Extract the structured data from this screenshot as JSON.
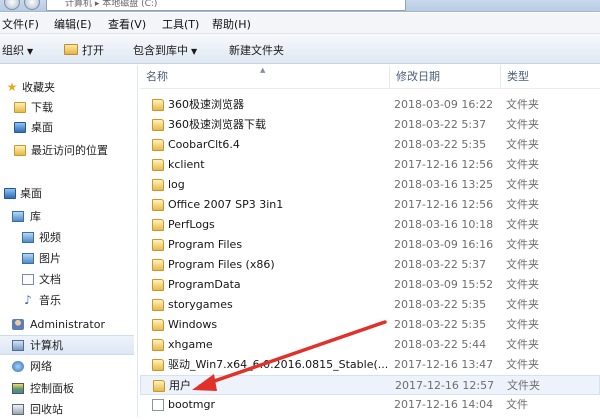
{
  "titlebar": {
    "path": "计算机 ▸ 本地磁盘 (C:)"
  },
  "menubar": {
    "items": [
      "文件(F)",
      "编辑(E)",
      "查看(V)",
      "工具(T)",
      "帮助(H)"
    ]
  },
  "toolbar": {
    "organize": "组织",
    "open": "打开",
    "include_in_library": "包含到库中",
    "new_folder": "新建文件夹"
  },
  "navpane": {
    "favorites": "收藏夹",
    "downloads": "下载",
    "desktop_fav": "桌面",
    "recent": "最近访问的位置",
    "desktop": "桌面",
    "libraries": "库",
    "videos": "视频",
    "pictures": "图片",
    "documents": "文档",
    "music": "音乐",
    "administrator": "Administrator",
    "computer": "计算机",
    "network": "网络",
    "control_panel": "控制面板",
    "recycle_bin": "回收站"
  },
  "columns": {
    "name": "名称",
    "date": "修改日期",
    "type": "类型"
  },
  "files": [
    {
      "name": "360极速浏览器",
      "date": "2018-03-09 16:22",
      "type": "文件夹",
      "icon": "folder-icon"
    },
    {
      "name": "360极速浏览器下载",
      "date": "2018-03-22 5:37",
      "type": "文件夹",
      "icon": "folder-icon"
    },
    {
      "name": "CoobarClt6.4",
      "date": "2018-03-22 5:35",
      "type": "文件夹",
      "icon": "folder-icon"
    },
    {
      "name": "kclient",
      "date": "2017-12-16 12:56",
      "type": "文件夹",
      "icon": "folder-icon"
    },
    {
      "name": "log",
      "date": "2018-03-16 13:25",
      "type": "文件夹",
      "icon": "folder-icon"
    },
    {
      "name": "Office 2007 SP3 3in1",
      "date": "2017-12-16 12:56",
      "type": "文件夹",
      "icon": "folder-icon"
    },
    {
      "name": "PerfLogs",
      "date": "2018-03-16 10:18",
      "type": "文件夹",
      "icon": "folder-icon"
    },
    {
      "name": "Program Files",
      "date": "2018-03-09 16:16",
      "type": "文件夹",
      "icon": "folder-icon"
    },
    {
      "name": "Program Files (x86)",
      "date": "2018-03-22 5:37",
      "type": "文件夹",
      "icon": "folder-icon"
    },
    {
      "name": "ProgramData",
      "date": "2018-03-09 15:52",
      "type": "文件夹",
      "icon": "folder-icon"
    },
    {
      "name": "storygames",
      "date": "2018-03-22 5:35",
      "type": "文件夹",
      "icon": "folder-icon"
    },
    {
      "name": "Windows",
      "date": "2018-03-22 5:35",
      "type": "文件夹",
      "icon": "folder-icon"
    },
    {
      "name": "xhgame",
      "date": "2018-03-22 5:44",
      "type": "文件夹",
      "icon": "folder-icon"
    },
    {
      "name": "驱动_Win7.x64_6.0.2016.0815_Stable(...",
      "date": "2017-12-16 13:47",
      "type": "文件夹",
      "icon": "folder-icon"
    },
    {
      "name": "用户",
      "date": "2017-12-16 12:57",
      "type": "文件夹",
      "icon": "folder-icon"
    },
    {
      "name": "bootmgr",
      "date": "2017-12-16 14:04",
      "type": "文件",
      "icon": "file-icon"
    }
  ],
  "colors": {
    "annotation_arrow": "#e0312b",
    "selection": "#eef3fb",
    "folder": "#e8b94a"
  }
}
